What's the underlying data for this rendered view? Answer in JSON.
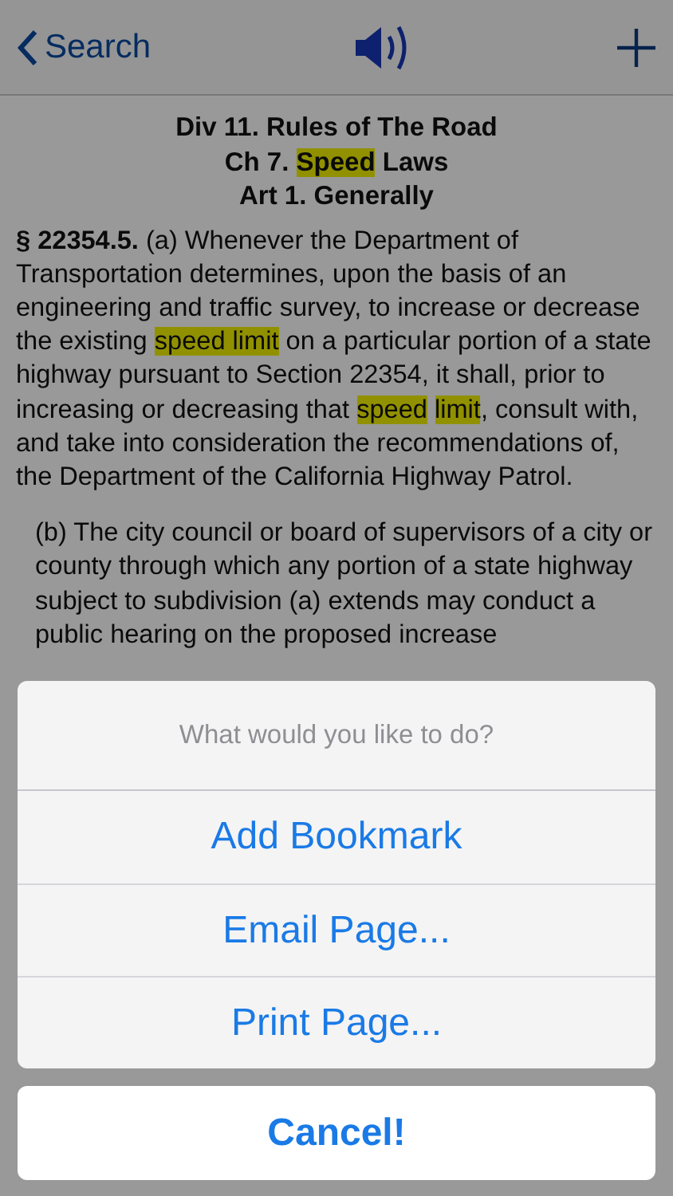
{
  "nav": {
    "back_label": "Search"
  },
  "headings": [
    [
      {
        "text": "Div 11. Rules of The Road",
        "highlight": false
      }
    ],
    [
      {
        "text": "Ch 7. ",
        "highlight": false
      },
      {
        "text": "Speed",
        "highlight": true
      },
      {
        "text": " Laws",
        "highlight": false
      }
    ],
    [
      {
        "text": "Art 1. Generally",
        "highlight": false
      }
    ]
  ],
  "paragraphs": [
    {
      "section": "§ 22354.5.",
      "segments": [
        {
          "text": " (a) Whenever the Department of Transportation determines, upon the basis of an engineering and traffic survey, to increase or decrease the existing ",
          "highlight": false
        },
        {
          "text": "speed limit",
          "highlight": true
        },
        {
          "text": " on a particular portion of a state highway pursuant to Section 22354, it shall, prior to increasing or decreasing that ",
          "highlight": false
        },
        {
          "text": "speed ",
          "highlight": true
        },
        {
          "text": "limit",
          "highlight": true
        },
        {
          "text": ", consult with, and take into consideration the recommendations of, the Department of the California Highway Patrol.",
          "highlight": false
        }
      ]
    },
    {
      "segments": [
        {
          "text": "(b) The city council or board of supervisors of a city or county through which any portion of a state highway subject to subdivision (a) extends may conduct a public hearing on the proposed increase",
          "highlight": false
        }
      ]
    }
  ],
  "action_sheet": {
    "title": "What would you like to do?",
    "actions": [
      "Add Bookmark",
      "Email Page...",
      "Print Page..."
    ],
    "cancel": "Cancel!"
  }
}
